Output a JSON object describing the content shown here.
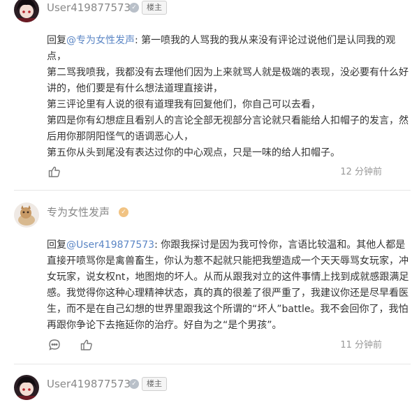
{
  "colors": {
    "mention": "#5b86c5",
    "muted": "#999999",
    "username": "#888888"
  },
  "comments": [
    {
      "username": "User419877573",
      "badge": "楼主",
      "reply_prefix": "回复",
      "mention": "@专为女性发声",
      "lines": [
        ": 第一喷我的人骂我的我从来没有评论过说他们是认同我的观点，",
        "第二骂我喷我，我都没有去理他们因为上来就骂人就是极端的表现，没必要有什么好讲的，他们要是有什么想法道理直接讲，",
        "第三评论里有人说的很有道理我有回复他们，你自己可以去看，",
        "第四是你有幻想症且看别人的言论全部无视部分言论就只看能给人扣帽子的发言，然后用你那阴阳怪气的语调恶心人，",
        "第五你从头到尾没有表达过你的中心观点，只是一味的给人扣帽子。"
      ],
      "time": "12 分钟前"
    },
    {
      "username": "专为女性发声",
      "reply_prefix": "回复",
      "mention": "@User419877573",
      "text": ": 你跟我探讨是因为我可怜你，言语比较温和。其他人都是直接开喷骂你是禽兽畜生，你认为惹不起就只能把我塑造成一个天天辱骂女玩家，冲女玩家，说女权nt，地图炮的坏人。从而从跟我对立的这件事情上找到成就感跟满足感。我觉得你这种心理精神状态，真的真的很差了很严重了，我建议你还是尽早看医生，而不是在自己幻想的世界里跟我这个所谓的“坏人”battle。我不会回你了，我怕再跟你争论下去拖延你的治疗。好自为之“是个男孩”。",
      "time": "11 分钟前"
    },
    {
      "username": "User419877573",
      "badge": "楼主"
    }
  ]
}
